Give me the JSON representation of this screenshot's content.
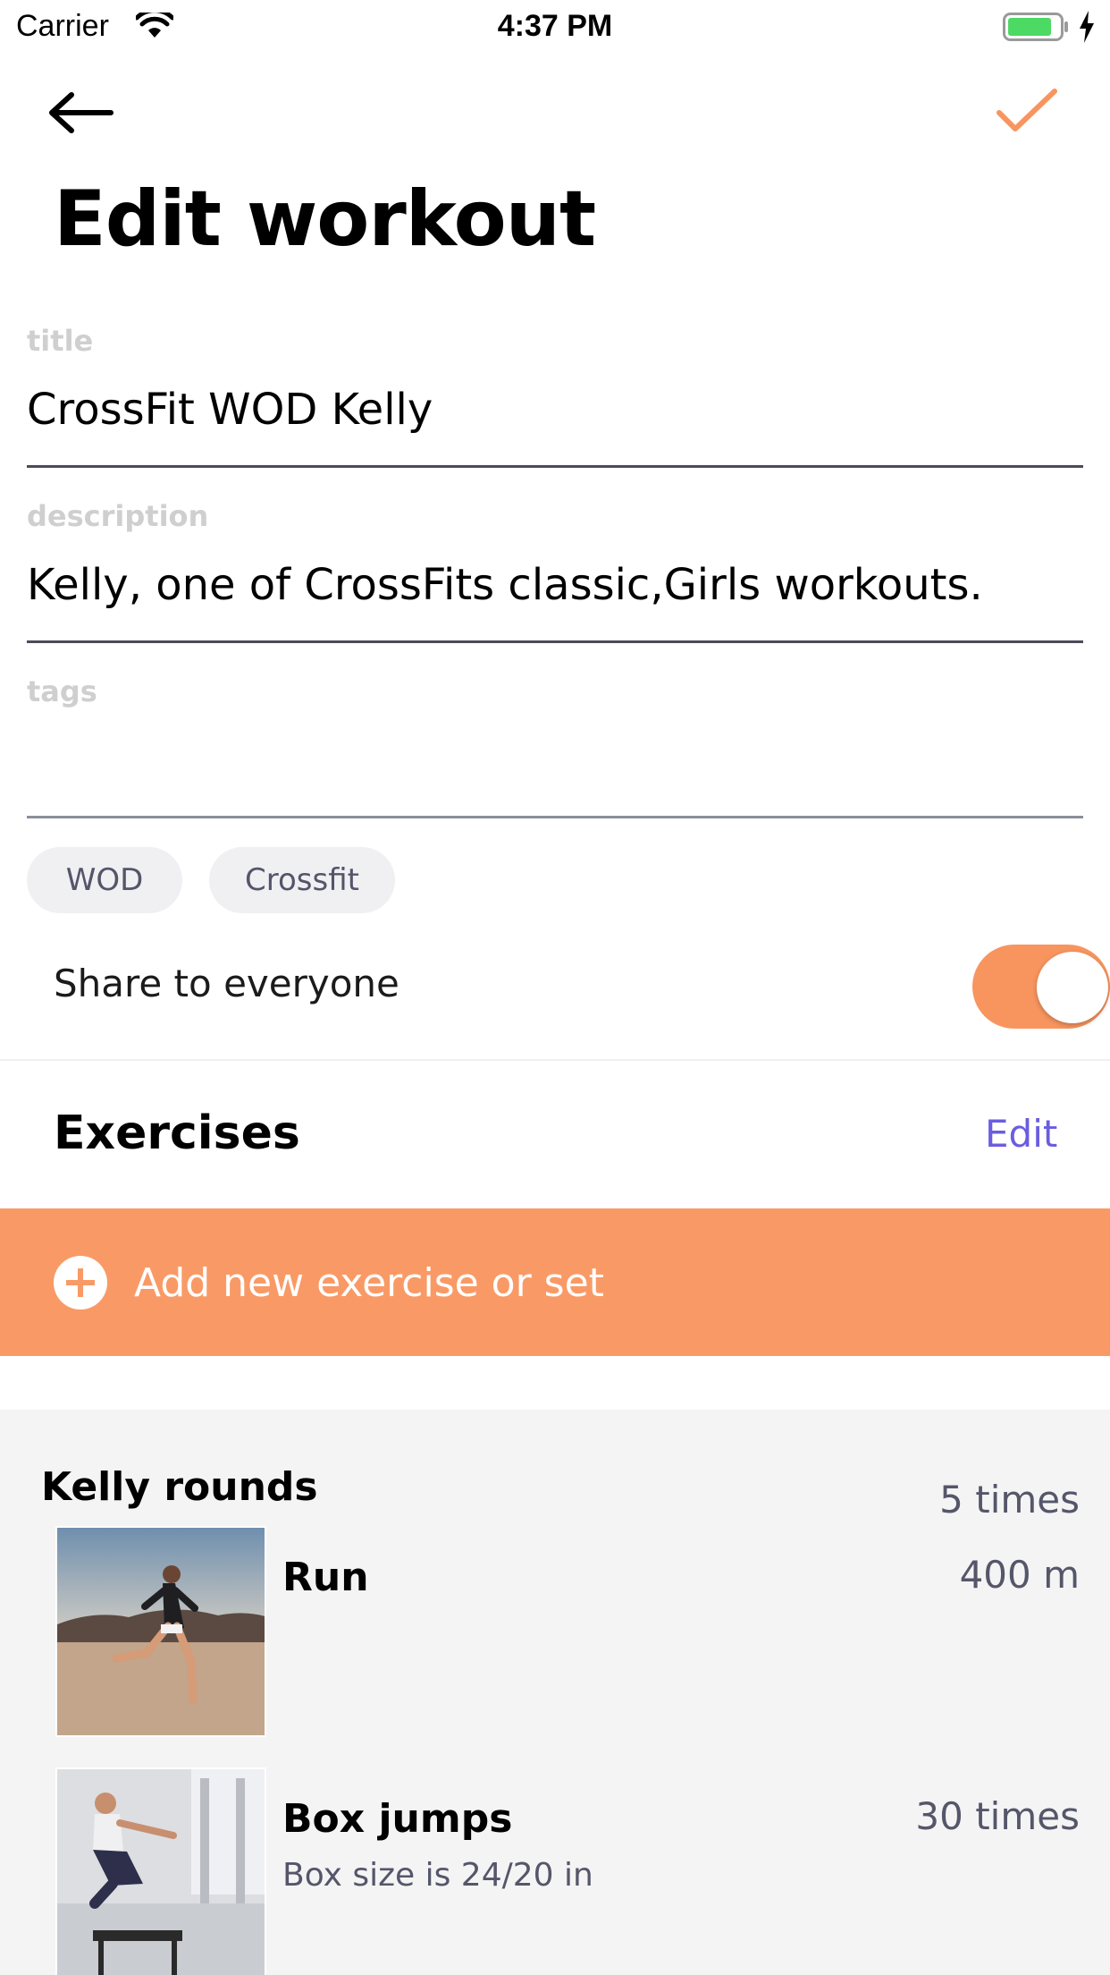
{
  "status_bar": {
    "carrier": "Carrier",
    "time": "4:37 PM",
    "wifi_icon": "wifi-icon",
    "battery_icon": "battery-charging-icon",
    "battery_color": "#4cd964"
  },
  "nav": {
    "back_icon": "arrow-left-icon",
    "save_icon": "checkmark-icon",
    "accent_color": "#f8955f"
  },
  "page": {
    "title": "Edit workout"
  },
  "form": {
    "title_label": "title",
    "title_value": "CrossFit WOD Kelly",
    "description_label": "description",
    "description_value": "Kelly, one of CrossFits classic,Girls workouts.",
    "tags_label": "tags",
    "tags_value": "",
    "tags": [
      "WOD",
      "Crossfit"
    ]
  },
  "share": {
    "label": "Share to everyone",
    "enabled": true
  },
  "exercises": {
    "title": "Exercises",
    "edit_label": "Edit",
    "add_label": "Add new exercise or set",
    "add_icon": "plus-circle-icon",
    "rounds": [
      {
        "name": "Kelly rounds",
        "count": "5 times",
        "items": [
          {
            "name": "Run",
            "amount": "400 m",
            "note": "",
            "image": "runner-photo"
          },
          {
            "name": "Box jumps",
            "amount": "30 times",
            "note": "Box size is 24/20 in",
            "image": "box-jump-photo"
          }
        ]
      }
    ]
  }
}
